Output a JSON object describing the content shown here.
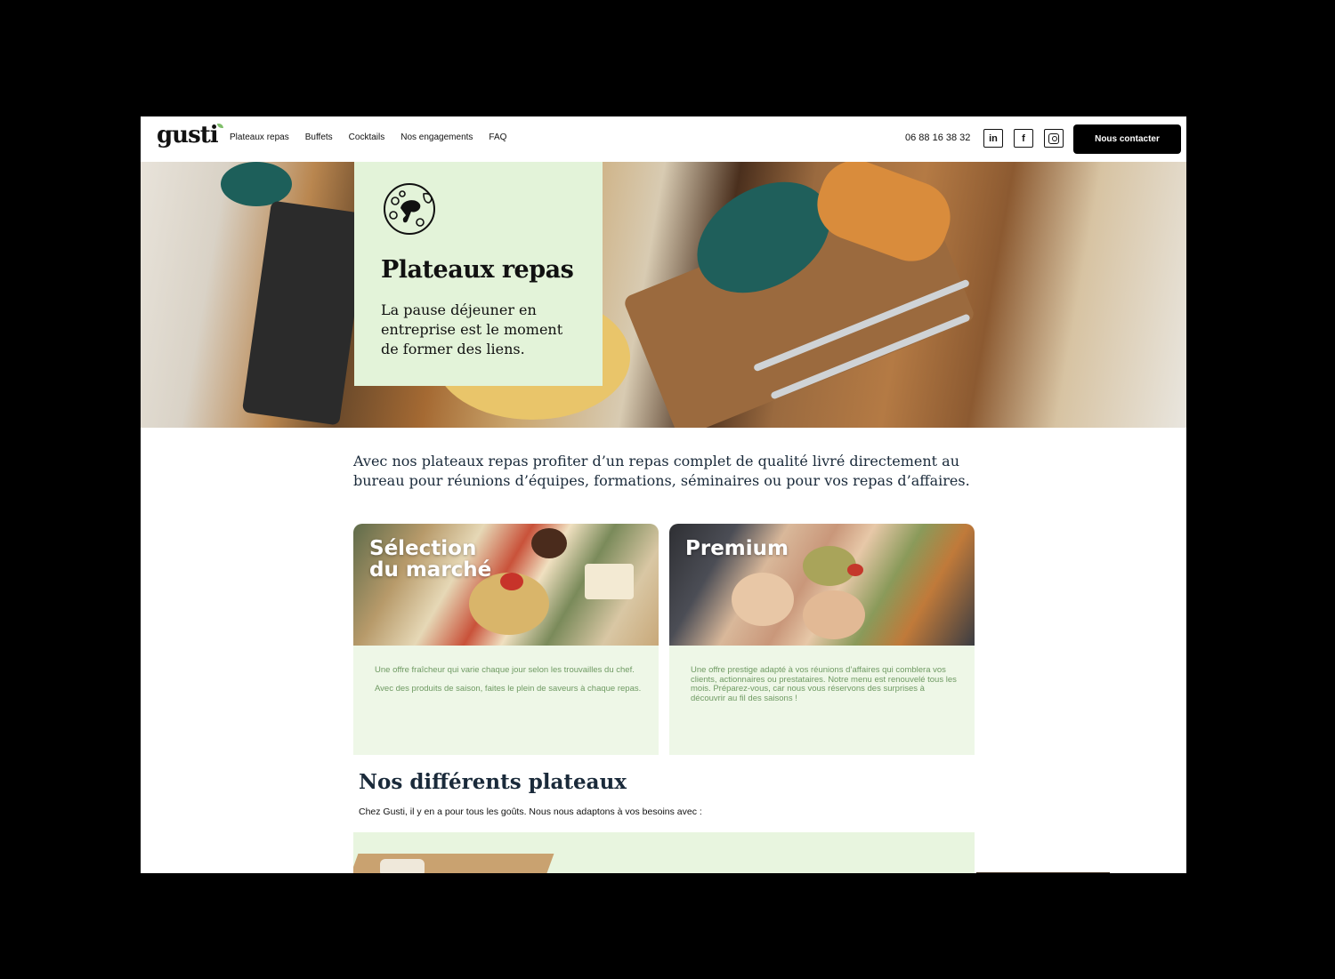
{
  "header": {
    "logo": "gusti",
    "nav": [
      "Plateaux repas",
      "Buffets",
      "Cocktails",
      "Nos engagements",
      "FAQ"
    ],
    "phone": "06 88 16 38 32",
    "social": [
      "in",
      "f",
      "instagram"
    ],
    "cta_label": "Nous contacter"
  },
  "hero": {
    "title": "Plateaux repas",
    "subtitle": "La pause déjeuner en entreprise est le moment de former des liens.",
    "icon": "plate-chicken-icon"
  },
  "intro": "Avec nos plateaux repas profiter d’un repas complet de qualité livré directement au bureau pour réunions d’équipes, formations, séminaires ou pour vos repas d’affaires.",
  "offers": [
    {
      "title_line1": "Sélection",
      "title_line2": "du marché",
      "para1": "Une offre fraîcheur qui varie chaque jour selon les trouvailles du chef.",
      "para2": "Avec des produits de saison, faites le plein de saveurs à chaque repas."
    },
    {
      "title_line1": "Premium",
      "title_line2": "",
      "para1": "Une offre prestige adapté à vos réunions d’affaires qui comblera vos clients, actionnaires ou prestataires. Notre menu est renouvelé tous les mois. Préparez-vous, car nous vous réservons des surprises à découvrir au fil des saisons !",
      "para2": ""
    }
  ],
  "section": {
    "title": "Nos différents plateaux",
    "subtitle": "Chez Gusti, il y en a pour tous les goûts. Nous nous adaptons à vos besoins avec :"
  },
  "colors": {
    "accent_green_light": "#e3f3d9",
    "offer_bg": "#eef7e7",
    "offer_text": "#6f9a63",
    "cta_bg": "#000000"
  }
}
